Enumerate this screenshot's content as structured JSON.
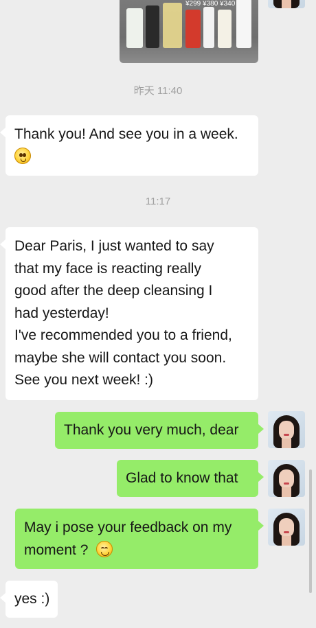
{
  "photo": {
    "price_text": "¥299  ¥380  ¥340"
  },
  "timestamps": [
    "昨天 11:40",
    "11:17"
  ],
  "messages": [
    {
      "side": "left",
      "lines": [
        "Thank you! And see you in a week."
      ],
      "emoji": "flushed-face"
    },
    {
      "side": "left",
      "lines": [
        "Dear Paris, I just wanted to say",
        "that my face is reacting really",
        "good after the deep cleansing I",
        "had yesterday!",
        "I've recommended you to a friend,",
        "maybe she will contact you soon.",
        "See you next week! :)"
      ]
    },
    {
      "side": "right",
      "lines": [
        "Thank you very much, dear"
      ]
    },
    {
      "side": "right",
      "lines": [
        "Glad to know that"
      ]
    },
    {
      "side": "right",
      "lines": [
        "May i pose your feedback on my",
        "moment ?"
      ],
      "emoji": "smiling-face"
    },
    {
      "side": "left",
      "lines": [
        "yes :)"
      ]
    }
  ],
  "icons": {
    "flushed": "flushed-face-emoji-icon",
    "smile": "smiling-face-emoji-icon",
    "avatar": "user-avatar"
  },
  "colors": {
    "background": "#ededed",
    "incoming": "#ffffff",
    "outgoing": "#95ec69",
    "timestamp": "#a0a0a0"
  }
}
